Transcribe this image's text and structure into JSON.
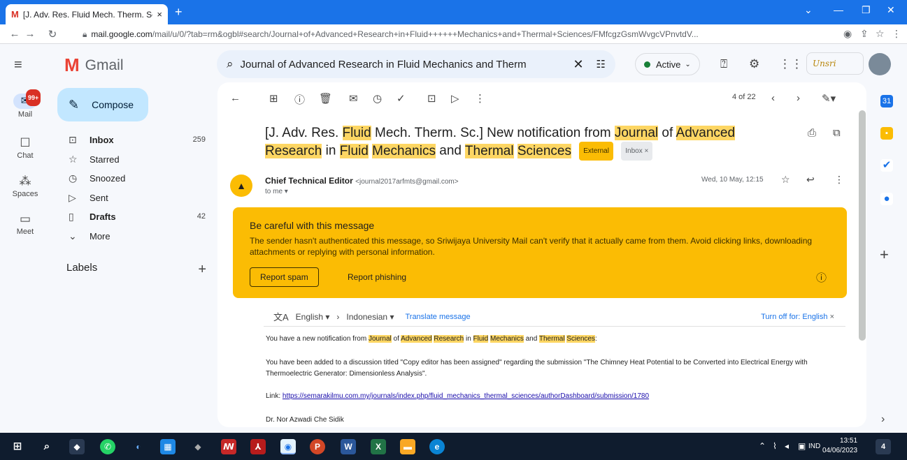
{
  "browser": {
    "tab_title": "[J. Adv. Res. Fluid Mech. Therm. Sc.",
    "tab_close": "×",
    "new_tab": "+",
    "url_host": "mail.google.com",
    "url_path": "/mail/u/0/?tab=rm&ogbl#search/Journal+of+Advanced+Research+in+Fluid++++++Mechanics+and+Thermal+Sciences/FMfcgzGsmWvgcVPnvtdV...",
    "win_min": "—",
    "win_max": "❐",
    "win_close": "✕"
  },
  "gmail": {
    "app_name": "Gmail",
    "search_query": "Journal of Advanced Research in Fluid    Mechanics and Therm",
    "status": "Active",
    "org_logo": "Unsri"
  },
  "rail": {
    "mail_badge": "99+",
    "items": [
      {
        "label": "Mail"
      },
      {
        "label": "Chat"
      },
      {
        "label": "Spaces"
      },
      {
        "label": "Meet"
      }
    ]
  },
  "nav": {
    "compose": "Compose",
    "folders": [
      {
        "name": "Inbox",
        "count": "259"
      },
      {
        "name": "Starred",
        "count": ""
      },
      {
        "name": "Snoozed",
        "count": ""
      },
      {
        "name": "Sent",
        "count": ""
      },
      {
        "name": "Drafts",
        "count": "42"
      },
      {
        "name": "More",
        "count": ""
      }
    ],
    "labels_title": "Labels"
  },
  "message": {
    "pager": "4 of 22",
    "subject_parts": {
      "p1": "[J. Adv. Res. ",
      "h1": "Fluid",
      "p2": " Mech. Therm. Sc.] New notification from ",
      "h2": "Journal",
      "p3": " of ",
      "h3": "Advanced",
      "h4": "Research",
      "p4": " in ",
      "h5": "Fluid",
      "p5": " ",
      "h6": "Mechanics",
      "p6": " and ",
      "h7": "Thermal",
      "p7": " ",
      "h8": "Sciences"
    },
    "tag_external": "External",
    "tag_inbox": "Inbox ×",
    "sender_name": "Chief Technical Editor",
    "sender_email": "<journal2017arfmts@gmail.com>",
    "to_me": "to me ▾",
    "date": "Wed, 10 May, 12:15",
    "alert": {
      "title": "Be careful with this message",
      "desc": "The sender hasn't authenticated this message, so Sriwijaya University Mail can't verify that it actually came from them. Avoid clicking links, downloading attachments or replying with personal information.",
      "report_spam": "Report spam",
      "report_phishing": "Report phishing"
    },
    "translate": {
      "from_lang": "English ▾",
      "to_lang": "Indonesian ▾",
      "action": "Translate message",
      "turn_off": "Turn off for: English"
    },
    "body": {
      "line1_parts": {
        "a": "You have a new notification from ",
        "h1": "Journal",
        "b": " of ",
        "h2": "Advanced",
        "c": " ",
        "h3": "Research",
        "d": " in ",
        "h4": "Fluid",
        "e": " ",
        "h5": "Mechanics",
        "f": " and ",
        "h6": "Thermal",
        "g": " ",
        "h7": "Sciences",
        "h": ":"
      },
      "para2": "You have been added to a discussion titled \"Copy editor has been assigned\" regarding the submission \"The Chimney Heat Potential to be Converted into Electrical Energy with Thermoelectric Generator: Dimensionless Analysis\".",
      "link_label": "Link: ",
      "link_url": "https://semarakilmu.com.my/journals/index.php/fluid_mechanics_thermal_sciences/authorDashboard/submission/1780",
      "signature": "Dr. Nor Azwadi Che Sidik"
    }
  },
  "taskbar": {
    "lang": "IND",
    "time": "13:51",
    "date": "04/06/2023",
    "notif_count": "4"
  },
  "colors": {
    "accent": "#1a73e8",
    "warning": "#fbbc04",
    "highlight": "#fdd663",
    "compose_bg": "#c2e7ff"
  }
}
